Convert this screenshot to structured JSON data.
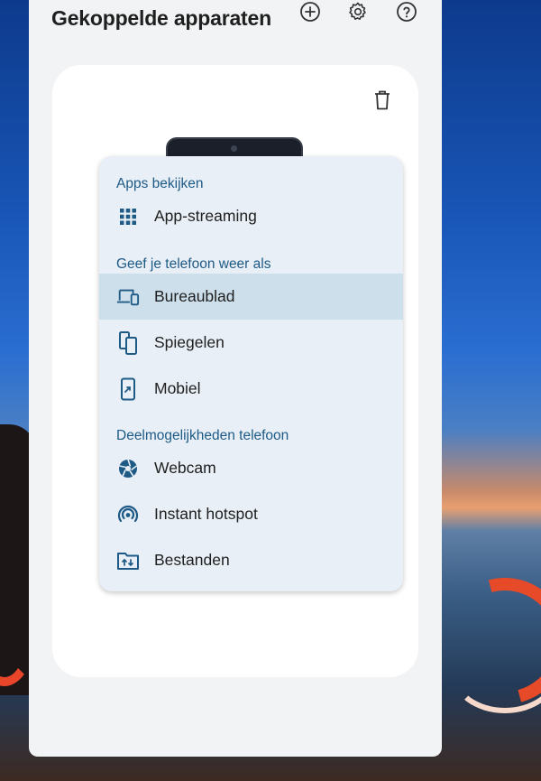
{
  "header": {
    "title": "Gekoppelde apparaten",
    "add_icon": "plus-circle-icon",
    "settings_icon": "gear-icon",
    "help_icon": "question-circle-icon"
  },
  "card": {
    "delete_icon": "trash-icon"
  },
  "menu": {
    "sections": [
      {
        "label": "Apps bekijken"
      },
      {
        "label": "Geef je telefoon weer als"
      },
      {
        "label": "Deelmogelijkheden telefoon"
      }
    ],
    "items": [
      {
        "label": "App-streaming",
        "icon": "grid-icon"
      },
      {
        "label": "Bureaublad",
        "icon": "laptop-phone-icon",
        "selected": true
      },
      {
        "label": "Spiegelen",
        "icon": "mirror-phones-icon"
      },
      {
        "label": "Mobiel",
        "icon": "phone-cast-icon"
      },
      {
        "label": "Webcam",
        "icon": "aperture-icon"
      },
      {
        "label": "Instant hotspot",
        "icon": "hotspot-icon"
      },
      {
        "label": "Bestanden",
        "icon": "folder-transfer-icon"
      }
    ]
  },
  "colors": {
    "accent": "#1e5a86",
    "menu_bg": "#e8eff6",
    "selected_bg": "#cddfea",
    "panel_bg": "#f1f3f4"
  }
}
